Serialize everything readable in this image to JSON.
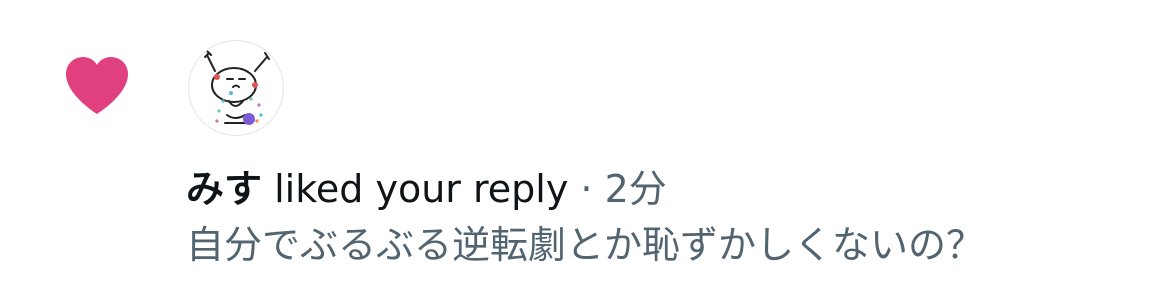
{
  "notification": {
    "type_icon": "heart-icon",
    "type_icon_color": "#e0407e",
    "avatar_icon": "user-avatar-drawing",
    "username": "みす",
    "action_text": "liked your reply",
    "separator": "·",
    "time_ago": "2分",
    "reply_text": "自分でぶるぶる逆転劇とか恥ずかしくないの？"
  },
  "colors": {
    "primary_text": "#0f1419",
    "secondary_text": "#536471",
    "like_pink": "#e0407e"
  }
}
